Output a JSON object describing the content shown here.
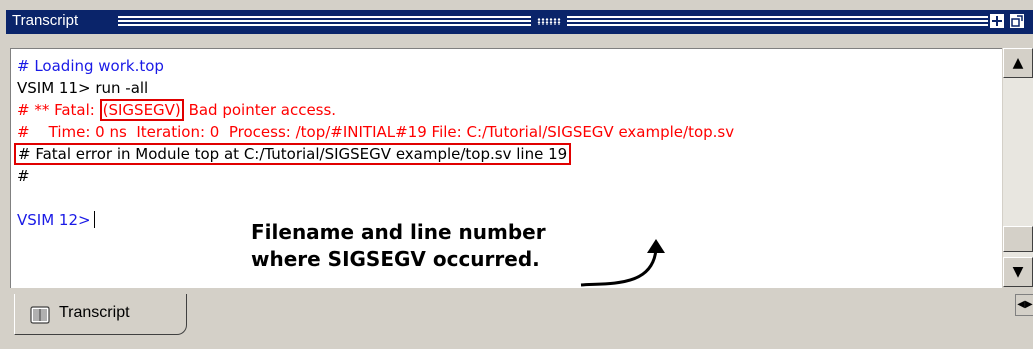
{
  "titlebar": {
    "title": "Transcript",
    "buttons": [
      "+",
      "◩"
    ]
  },
  "transcript": {
    "line1": "# Loading work.top",
    "line2": "VSIM 11> run -all",
    "line3_prefix": "# ** Fatal: ",
    "line3_boxed": "(SIGSEGV)",
    "line3_suffix": " Bad pointer access.",
    "line4": "#    Time: 0 ns  Iteration: 0  Process: /top/#INITIAL#19 File: C:/Tutorial/SIGSEGV example/top.sv",
    "line5": "# Fatal error in Module top at C:/Tutorial/SIGSEGV example/top.sv line 19",
    "line6": "#",
    "line7": "",
    "prompt": "VSIM 12>"
  },
  "annotation": {
    "line1": "Filename and line number",
    "line2": "where SIGSEGV occurred."
  },
  "scrollbar": {
    "up": "▲",
    "down": "▼"
  },
  "tabs": {
    "active_label": "Transcript",
    "nav": "◀▶"
  },
  "colors": {
    "comment_blue": "#1a1ae6",
    "error_red": "#ff0000",
    "titlebar": "#0a246a",
    "highlight_box": "#e00000"
  }
}
